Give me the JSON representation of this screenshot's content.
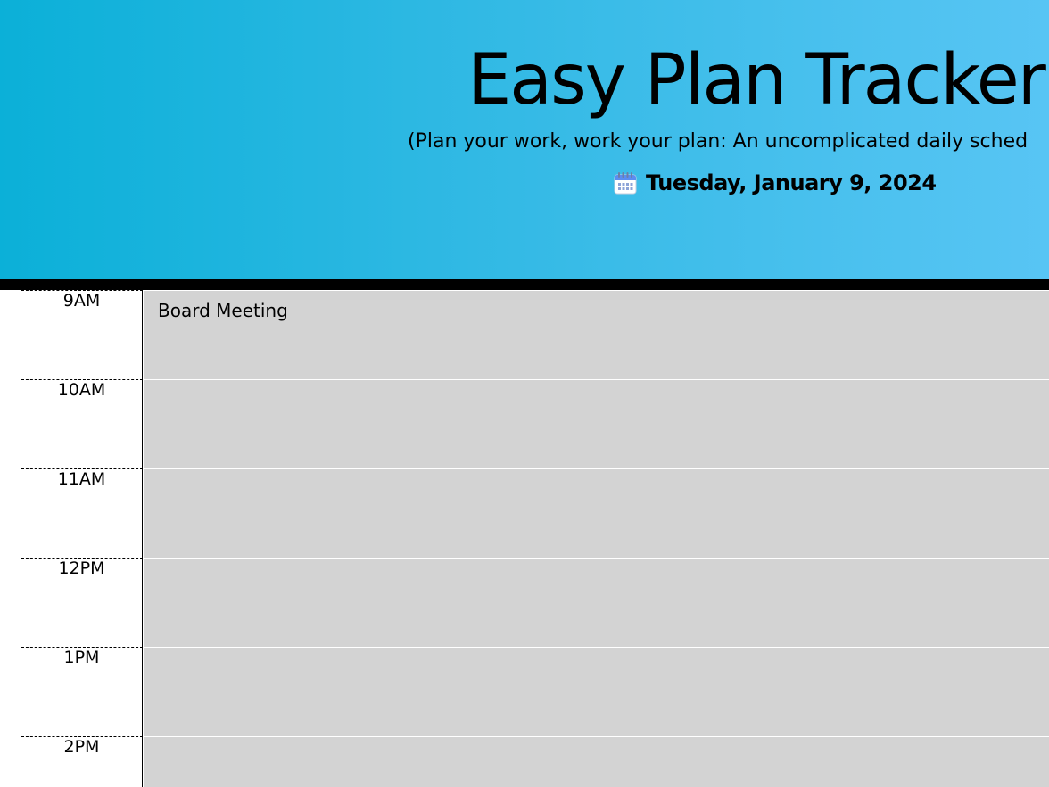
{
  "header": {
    "title": "Easy Plan Tracker",
    "subtitle": "(Plan your work, work your plan: An uncomplicated daily sched",
    "date_icon": "calendar-icon",
    "date": "Tuesday, January 9, 2024"
  },
  "schedule": [
    {
      "hour": "9AM",
      "entry": "Board Meeting"
    },
    {
      "hour": "10AM",
      "entry": ""
    },
    {
      "hour": "11AM",
      "entry": ""
    },
    {
      "hour": "12PM",
      "entry": ""
    },
    {
      "hour": "1PM",
      "entry": ""
    },
    {
      "hour": "2PM",
      "entry": ""
    }
  ],
  "colors": {
    "header_gradient_start": "#0bb0d8",
    "header_gradient_end": "#58c5f4",
    "slot_background": "#d3d3d3",
    "divider": "#000000"
  }
}
